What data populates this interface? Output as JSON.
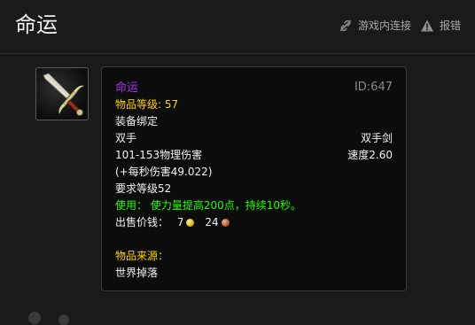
{
  "header": {
    "title": "命运",
    "actions": [
      {
        "label": "游戏内连接",
        "icon": "link-icon"
      },
      {
        "label": "报错",
        "icon": "warning-icon"
      }
    ]
  },
  "item": {
    "icon": "sword-icon",
    "name": "命运",
    "id": "ID:647",
    "item_level": "物品等级: 57",
    "bind": "装备绑定",
    "slot": "双手",
    "type": "双手剑",
    "damage": "101-153物理伤害",
    "speed": "速度2.60",
    "dps": "(+每秒伤害49.022)",
    "required_level": "要求等级52",
    "use_effect": "使用： 使力量提高200点，持续10秒。",
    "sell_label": "出售价钱：",
    "sell_gold": "7",
    "sell_silver": "24",
    "source_label": "物品来源：",
    "source_value": "世界掉落"
  },
  "colors": {
    "epic": "#a335ee",
    "gold_text": "#ffd100",
    "use_green": "#1eff00",
    "background": "#1a1a1a",
    "tooltip_bg": "#0c0c0c"
  }
}
